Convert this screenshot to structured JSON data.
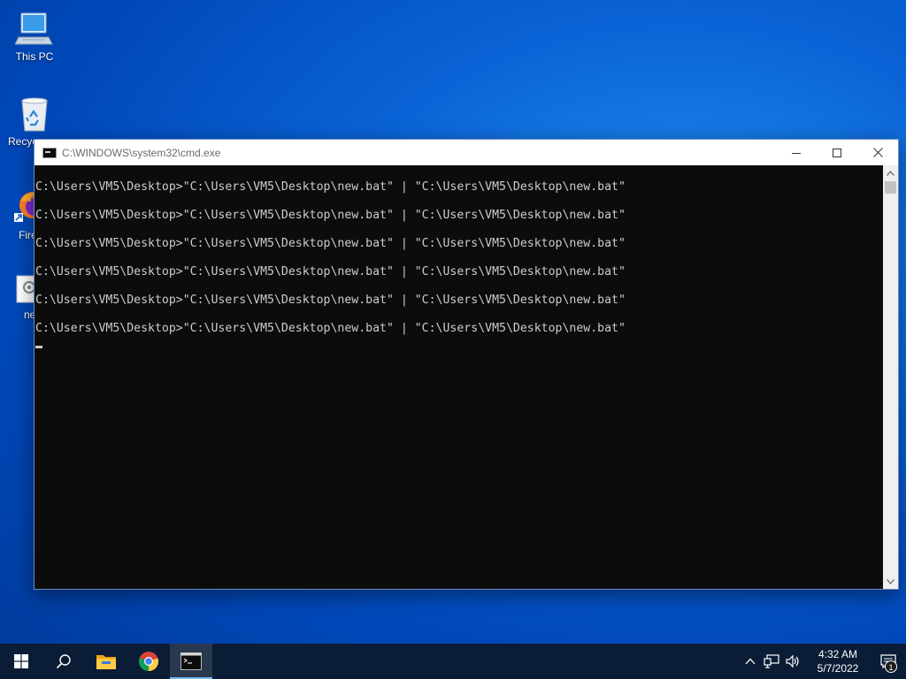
{
  "desktop": {
    "icons": [
      {
        "label": "This PC",
        "icon": "this-pc-icon"
      },
      {
        "label": "Recyc",
        "icon": "recycle-bin-icon"
      },
      {
        "label": "Fire",
        "icon": "firefox-icon"
      },
      {
        "label": "ne",
        "icon": "bat-file-icon"
      }
    ]
  },
  "cmd_window": {
    "title": "C:\\WINDOWS\\system32\\cmd.exe",
    "lines": [
      "C:\\Users\\VM5\\Desktop>\"C:\\Users\\VM5\\Desktop\\new.bat\" | \"C:\\Users\\VM5\\Desktop\\new.bat\"",
      "C:\\Users\\VM5\\Desktop>\"C:\\Users\\VM5\\Desktop\\new.bat\" | \"C:\\Users\\VM5\\Desktop\\new.bat\"",
      "C:\\Users\\VM5\\Desktop>\"C:\\Users\\VM5\\Desktop\\new.bat\" | \"C:\\Users\\VM5\\Desktop\\new.bat\"",
      "C:\\Users\\VM5\\Desktop>\"C:\\Users\\VM5\\Desktop\\new.bat\" | \"C:\\Users\\VM5\\Desktop\\new.bat\"",
      "C:\\Users\\VM5\\Desktop>\"C:\\Users\\VM5\\Desktop\\new.bat\" | \"C:\\Users\\VM5\\Desktop\\new.bat\"",
      "C:\\Users\\VM5\\Desktop>\"C:\\Users\\VM5\\Desktop\\new.bat\" | \"C:\\Users\\VM5\\Desktop\\new.bat\""
    ],
    "background_color": "#0c0c0c",
    "text_color": "#cccccc"
  },
  "taskbar": {
    "items": [
      {
        "icon": "windows-start-icon"
      },
      {
        "icon": "search-icon"
      },
      {
        "icon": "file-explorer-icon"
      },
      {
        "icon": "chrome-icon"
      },
      {
        "icon": "cmd-icon",
        "active": true
      }
    ],
    "tray": {
      "icons": [
        "chevron-up-icon",
        "network-icon",
        "volume-icon"
      ],
      "time": "4:32 AM",
      "date": "5/7/2022",
      "notification_count": "1"
    }
  },
  "colors": {
    "taskbar": "#0b1d36",
    "accent": "#76b9ed"
  }
}
